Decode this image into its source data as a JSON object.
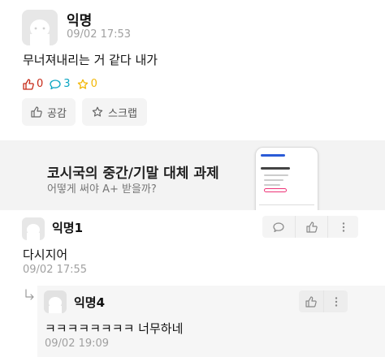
{
  "post": {
    "author": "익명",
    "time": "09/02 17:53",
    "body": "무너져내리는 거 같다 내가",
    "counts": {
      "likes": "0",
      "comments": "3",
      "scraps": "0"
    },
    "like_button_label": "공감",
    "scrap_button_label": "스크랩"
  },
  "ad": {
    "title": "코시국의 중간/기말 대체 과제",
    "subtitle": "어떻게 써야 A+ 받을까?"
  },
  "comments": [
    {
      "author": "익명1",
      "body": "다시지어",
      "time": "09/02 17:55",
      "actions": [
        "comment-icon",
        "like-icon",
        "more-icon"
      ]
    },
    {
      "author": "익명4",
      "body": "ㅋㅋㅋㅋㅋㅋㅋㅋ 너무하네",
      "time": "09/02 19:09",
      "actions": [
        "like-icon",
        "more-icon"
      ],
      "is_reply": true
    }
  ],
  "colors": {
    "like": "#c62917",
    "comment": "#0aa5c2",
    "scrap": "#f2b705",
    "muted": "#a0a0a0",
    "ad_bg": "#f3f3f3"
  }
}
